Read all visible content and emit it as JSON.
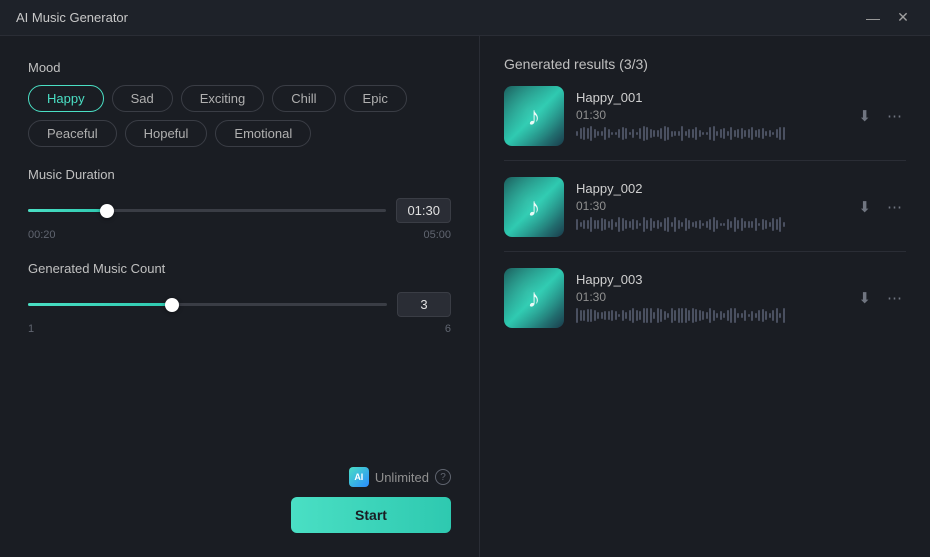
{
  "titleBar": {
    "title": "AI Music Generator",
    "minimizeLabel": "—",
    "closeLabel": "✕"
  },
  "leftPanel": {
    "moodLabel": "Mood",
    "moods": [
      {
        "id": "happy",
        "label": "Happy",
        "active": true
      },
      {
        "id": "sad",
        "label": "Sad",
        "active": false
      },
      {
        "id": "exciting",
        "label": "Exciting",
        "active": false
      },
      {
        "id": "chill",
        "label": "Chill",
        "active": false
      },
      {
        "id": "epic",
        "label": "Epic",
        "active": false
      },
      {
        "id": "peaceful",
        "label": "Peaceful",
        "active": false
      },
      {
        "id": "hopeful",
        "label": "Hopeful",
        "active": false
      },
      {
        "id": "emotional",
        "label": "Emotional",
        "active": false
      }
    ],
    "durationLabel": "Music Duration",
    "durationValue": "01:30",
    "durationMin": "00:20",
    "durationMax": "05:00",
    "durationPercent": 22,
    "countLabel": "Generated Music Count",
    "countValue": "3",
    "countMin": "1",
    "countMax": "6",
    "countPercent": 40,
    "unlimitedLabel": "Unlimited",
    "aiBadgeLabel": "AI",
    "startLabel": "Start"
  },
  "rightPanel": {
    "resultsHeader": "Generated results (3/3)",
    "results": [
      {
        "id": "001",
        "name": "Happy_001",
        "time": "01:30"
      },
      {
        "id": "002",
        "name": "Happy_002",
        "time": "01:30"
      },
      {
        "id": "003",
        "name": "Happy_003",
        "time": "01:30"
      }
    ]
  },
  "colors": {
    "accent": "#4adfc4",
    "bg": "#1a1d23",
    "panel": "#1e2229"
  }
}
